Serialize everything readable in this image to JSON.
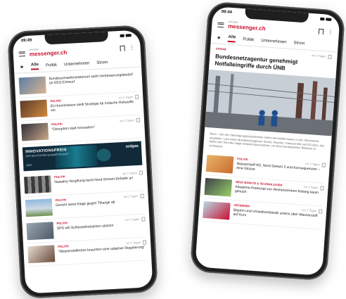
{
  "left_phone": {
    "time": "09:49",
    "logo_small": "energate",
    "logo_main": "messenger.ch",
    "tabs": [
      "Alle",
      "Politik",
      "Unternehmen",
      "Strom"
    ],
    "items": [
      {
        "category": "",
        "age": "",
        "title": "Bundesumweltministerium sieht Verbesserungsbedarf an EEG-Entwurf"
      },
      {
        "category": "POLITIK",
        "age": "vor 2 Tagen",
        "title": "EU-Kommission stellt Strategie für kritische Rohstoffe vor"
      },
      {
        "category": "POLITIK",
        "age": "vor 2 Tagen",
        "title": "\"Disruption statt Innovation\""
      },
      {
        "category": "POLITIK",
        "age": "vor 2 Tagen",
        "title": "Nawalny-Vergiftung facht Nord-Stream-Debatte an"
      },
      {
        "category": "POLITIK",
        "age": "vor 2 Tagen",
        "title": "Gericht weist Klage gegen Tihange ab"
      },
      {
        "category": "POLITIK",
        "age": "vor 2 Tagen",
        "title": "SPD will Schlüsselindustrien stützen"
      },
      {
        "category": "POLITIK",
        "age": "vor 2 Tagen",
        "title": "\"Wasserstoffnetze brauchen eine adaptive Regulierung\""
      }
    ],
    "ad": {
      "line1": "INNOVATIONSPREIS",
      "line2": "DER DEUTSCHEN GASWIRTSCHAFT",
      "year": "2020",
      "brand": "erdgas"
    }
  },
  "right_phone": {
    "time": "09:44",
    "logo_small": "energate",
    "logo_main": "messenger.ch",
    "tabs": [
      "Alle",
      "Politik",
      "Unternehmen",
      "Strom"
    ],
    "article": {
      "label": "STROM",
      "age": "vor 2 Tagen",
      "headline": "Bundesnetzagentur genehmigt Notfalleingriffe durch ÜNB",
      "lede": "Bonn – Die vier Übertragungsnetzbetreiber dürfen bei Notfall massiv in den Strommarkt eingreifen. Laut einem Bundesnetzagentur Tennet, Amprion, Transnet BW und 50 Hertz, den Markt zum Teil oder sogar komplett auszusetzen, um einen bundesweiten Blackout zu verhindern."
    },
    "items": [
      {
        "category": "POLITIK",
        "age": "vor 2 Tagen",
        "title": "Wasserstoff AG, Nord Stream 2 und Konsequenzen – eine Glosse"
      },
      {
        "category": "NEUE MÄRKTE & TECHNOLOGIEN",
        "age": "vor 2 Tagen",
        "title": "Abwärme-Potenzial von Rechenzentren bislang kaum genutzt"
      },
      {
        "category": "GEFERMEN",
        "age": "vor 2 Tagen",
        "title": "Bayern und Umweltverbände uneins über Wasserstoff auf Kurs"
      }
    ]
  },
  "colors": {
    "brand": "#c8102e",
    "phone_frame": "#1f1f1f"
  }
}
